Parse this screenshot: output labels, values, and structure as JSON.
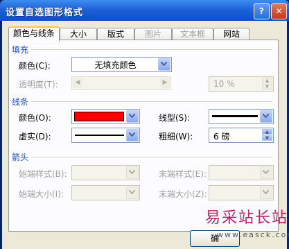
{
  "window": {
    "title": "设置自选图形格式",
    "help": "?",
    "close": "✕"
  },
  "tabs": [
    {
      "label": "颜色与线条",
      "state": "active"
    },
    {
      "label": "大小",
      "state": "normal"
    },
    {
      "label": "版式",
      "state": "normal"
    },
    {
      "label": "图片",
      "state": "disabled"
    },
    {
      "label": "文本框",
      "state": "disabled"
    },
    {
      "label": "网站",
      "state": "normal"
    }
  ],
  "fill": {
    "heading": "填充",
    "color_label": "颜色(C):",
    "color_value": "无填充颜色",
    "transparency_label": "透明度(T):",
    "transparency_value": "10 %"
  },
  "line": {
    "heading": "线条",
    "color_label": "颜色(O):",
    "color_value": "#ff0000",
    "dash_label": "虚实(D):",
    "style_label": "线型(S):",
    "weight_label": "粗细(W):",
    "weight_value": "6 磅"
  },
  "arrows": {
    "heading": "箭头",
    "begin_style_label": "始端样式(B):",
    "begin_size_label": "始端大小(I):",
    "end_style_label": "末端样式(E):",
    "end_size_label": "末端大小(Z):"
  },
  "buttons": {
    "ok": "确"
  },
  "watermark": {
    "text": "易采站长站",
    "url": "www.easck.com"
  }
}
